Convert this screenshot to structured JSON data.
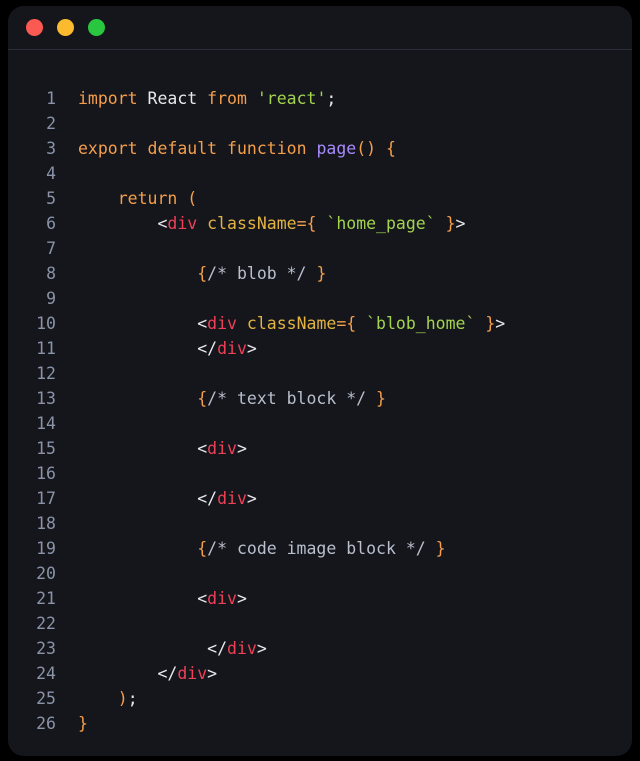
{
  "window": {
    "title": "",
    "controls": [
      {
        "name": "close",
        "color": "#fb5a52"
      },
      {
        "name": "minimize",
        "color": "#fcbb2e"
      },
      {
        "name": "maximize",
        "color": "#29c740"
      }
    ]
  },
  "editor": {
    "language": "jsx",
    "line_count": 26,
    "theme_background": "#14161c",
    "gutter_color": "#8b93a7",
    "lines": [
      {
        "n": "1",
        "indent": 0,
        "tokens": [
          {
            "t": "import",
            "c": "t-keyword"
          },
          {
            "t": " ",
            "c": "t-plain"
          },
          {
            "t": "React",
            "c": "t-ident"
          },
          {
            "t": " ",
            "c": "t-plain"
          },
          {
            "t": "from",
            "c": "t-keyword"
          },
          {
            "t": " ",
            "c": "t-plain"
          },
          {
            "t": "'react'",
            "c": "t-string"
          },
          {
            "t": ";",
            "c": "t-plain"
          }
        ]
      },
      {
        "n": "2",
        "indent": 0,
        "tokens": []
      },
      {
        "n": "3",
        "indent": 0,
        "tokens": [
          {
            "t": "export",
            "c": "t-keyword"
          },
          {
            "t": " ",
            "c": "t-plain"
          },
          {
            "t": "default",
            "c": "t-keyword"
          },
          {
            "t": " ",
            "c": "t-plain"
          },
          {
            "t": "function",
            "c": "t-keyword"
          },
          {
            "t": " ",
            "c": "t-plain"
          },
          {
            "t": "page",
            "c": "t-func"
          },
          {
            "t": "()",
            "c": "t-punct"
          },
          {
            "t": " ",
            "c": "t-plain"
          },
          {
            "t": "{",
            "c": "t-brace"
          }
        ]
      },
      {
        "n": "4",
        "indent": 0,
        "tokens": []
      },
      {
        "n": "5",
        "indent": 2,
        "tokens": [
          {
            "t": "return",
            "c": "t-keyword"
          },
          {
            "t": " ",
            "c": "t-plain"
          },
          {
            "t": "(",
            "c": "t-punct"
          }
        ]
      },
      {
        "n": "6",
        "indent": 4,
        "tokens": [
          {
            "t": "<",
            "c": "t-plain"
          },
          {
            "t": "div",
            "c": "t-tag"
          },
          {
            "t": " ",
            "c": "t-plain"
          },
          {
            "t": "className",
            "c": "t-attr"
          },
          {
            "t": "={",
            "c": "t-punct"
          },
          {
            "t": " ",
            "c": "t-plain"
          },
          {
            "t": "`home_page`",
            "c": "t-string"
          },
          {
            "t": " ",
            "c": "t-plain"
          },
          {
            "t": "}",
            "c": "t-punct"
          },
          {
            "t": ">",
            "c": "t-plain"
          }
        ]
      },
      {
        "n": "7",
        "indent": 0,
        "tokens": []
      },
      {
        "n": "8",
        "indent": 6,
        "tokens": [
          {
            "t": "{",
            "c": "t-brace"
          },
          {
            "t": "/* blob */",
            "c": "t-comment"
          },
          {
            "t": " ",
            "c": "t-plain"
          },
          {
            "t": "}",
            "c": "t-brace"
          }
        ]
      },
      {
        "n": "9",
        "indent": 0,
        "tokens": []
      },
      {
        "n": "10",
        "indent": 6,
        "tokens": [
          {
            "t": "<",
            "c": "t-plain"
          },
          {
            "t": "div",
            "c": "t-tag"
          },
          {
            "t": " ",
            "c": "t-plain"
          },
          {
            "t": "className",
            "c": "t-attr"
          },
          {
            "t": "={",
            "c": "t-punct"
          },
          {
            "t": " ",
            "c": "t-plain"
          },
          {
            "t": "`blob_home`",
            "c": "t-string"
          },
          {
            "t": " ",
            "c": "t-plain"
          },
          {
            "t": "}",
            "c": "t-punct"
          },
          {
            "t": ">",
            "c": "t-plain"
          }
        ]
      },
      {
        "n": "11",
        "indent": 6,
        "tokens": [
          {
            "t": "</",
            "c": "t-plain"
          },
          {
            "t": "div",
            "c": "t-tag"
          },
          {
            "t": ">",
            "c": "t-plain"
          }
        ]
      },
      {
        "n": "12",
        "indent": 0,
        "tokens": []
      },
      {
        "n": "13",
        "indent": 6,
        "tokens": [
          {
            "t": "{",
            "c": "t-brace"
          },
          {
            "t": "/* text block */",
            "c": "t-comment"
          },
          {
            "t": " ",
            "c": "t-plain"
          },
          {
            "t": "}",
            "c": "t-brace"
          }
        ]
      },
      {
        "n": "14",
        "indent": 0,
        "tokens": []
      },
      {
        "n": "15",
        "indent": 6,
        "tokens": [
          {
            "t": "<",
            "c": "t-plain"
          },
          {
            "t": "div",
            "c": "t-tag"
          },
          {
            "t": ">",
            "c": "t-plain"
          }
        ]
      },
      {
        "n": "16",
        "indent": 0,
        "tokens": []
      },
      {
        "n": "17",
        "indent": 6,
        "tokens": [
          {
            "t": "</",
            "c": "t-plain"
          },
          {
            "t": "div",
            "c": "t-tag"
          },
          {
            "t": ">",
            "c": "t-plain"
          }
        ]
      },
      {
        "n": "18",
        "indent": 0,
        "tokens": []
      },
      {
        "n": "19",
        "indent": 6,
        "tokens": [
          {
            "t": "{",
            "c": "t-brace"
          },
          {
            "t": "/* code image block */",
            "c": "t-comment"
          },
          {
            "t": " ",
            "c": "t-plain"
          },
          {
            "t": "}",
            "c": "t-brace"
          }
        ]
      },
      {
        "n": "20",
        "indent": 0,
        "tokens": []
      },
      {
        "n": "21",
        "indent": 6,
        "tokens": [
          {
            "t": "<",
            "c": "t-plain"
          },
          {
            "t": "div",
            "c": "t-tag"
          },
          {
            "t": ">",
            "c": "t-plain"
          }
        ]
      },
      {
        "n": "22",
        "indent": 0,
        "tokens": []
      },
      {
        "n": "23",
        "indent": 6,
        "tokens": [
          {
            "t": " ",
            "c": "t-plain"
          },
          {
            "t": "</",
            "c": "t-plain"
          },
          {
            "t": "div",
            "c": "t-tag"
          },
          {
            "t": ">",
            "c": "t-plain"
          }
        ]
      },
      {
        "n": "24",
        "indent": 4,
        "tokens": [
          {
            "t": "</",
            "c": "t-plain"
          },
          {
            "t": "div",
            "c": "t-tag"
          },
          {
            "t": ">",
            "c": "t-plain"
          }
        ]
      },
      {
        "n": "25",
        "indent": 2,
        "tokens": [
          {
            "t": ")",
            "c": "t-punct"
          },
          {
            "t": ";",
            "c": "t-plain"
          }
        ]
      },
      {
        "n": "26",
        "indent": 0,
        "tokens": [
          {
            "t": "}",
            "c": "t-brace"
          }
        ]
      }
    ]
  }
}
